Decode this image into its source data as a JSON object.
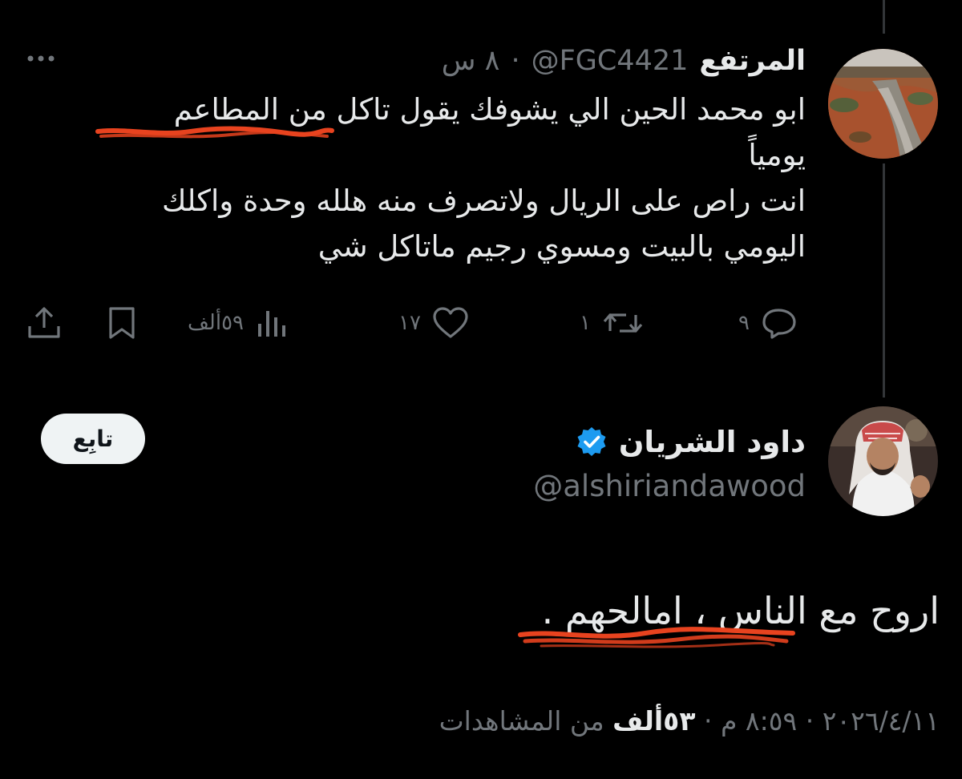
{
  "parent_tweet": {
    "display_name": "المرتفع",
    "handle": "@FGC4421",
    "separator": "·",
    "time": "٨ س",
    "text_lines": [
      "ابو محمد الحين الي يشوفك يقول تاكل من المطاعم",
      "يومياً",
      "انت راص على الريال ولاتصرف منه هلله وحدة واكلك",
      "اليومي بالبيت ومسوي رجيم ماتاكل شي"
    ],
    "actions": {
      "replies": "٩",
      "retweets": "١",
      "likes": "١٧",
      "views": "٥٩ألف"
    },
    "icons": [
      "more-icon",
      "reply-icon",
      "retweet-icon",
      "like-icon",
      "views-icon",
      "bookmark-icon",
      "share-icon"
    ]
  },
  "main_tweet": {
    "display_name": "داود الشريان",
    "handle": "@alshiriandawood",
    "verified": true,
    "follow_label": "تابِع",
    "text": "اروح مع الناس ، امالحهم .",
    "date": "٢٠٢٦/٤/١١",
    "time": "٨:٥٩ م",
    "separator": "·",
    "views_count": "٥٣ألف",
    "views_label": "من المشاهدات"
  },
  "colors": {
    "background": "#000000",
    "text": "#e7e9ea",
    "muted": "#71767b",
    "verified": "#1d9bf0",
    "highlight": "#e8431f"
  }
}
